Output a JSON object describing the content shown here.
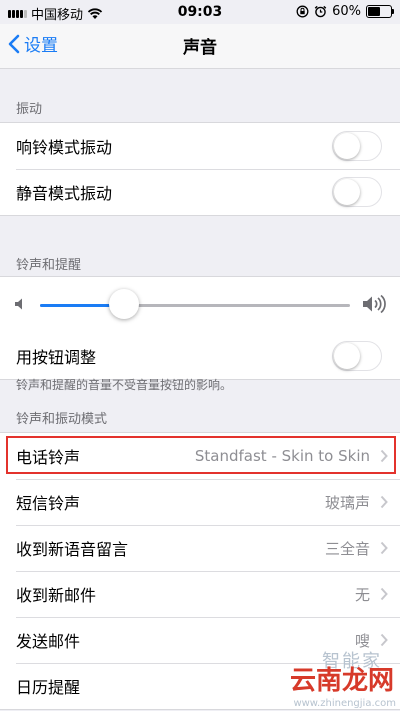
{
  "status_bar": {
    "carrier": "中国移动",
    "time": "09:03",
    "battery": "60%",
    "battery_level": 0.6
  },
  "nav": {
    "back_label": "设置",
    "title": "声音"
  },
  "vibration": {
    "header": "振动",
    "rows": [
      {
        "label": "响铃模式振动",
        "on": false
      },
      {
        "label": "静音模式振动",
        "on": false
      }
    ]
  },
  "ringer": {
    "header": "铃声和提醒",
    "volume_level": 0.27,
    "button_adjust_label": "用按钮调整",
    "button_adjust_on": false,
    "note": "铃声和提醒的音量不受音量按钮的影响。"
  },
  "patterns": {
    "header": "铃声和振动模式",
    "rows": [
      {
        "label": "电话铃声",
        "value": "Standfast - Skin to Skin"
      },
      {
        "label": "短信铃声",
        "value": "玻璃声"
      },
      {
        "label": "收到新语音留言",
        "value": "三全音"
      },
      {
        "label": "收到新邮件",
        "value": "无"
      },
      {
        "label": "发送邮件",
        "value": "嗖"
      },
      {
        "label": "日历提醒",
        "value": ""
      }
    ]
  },
  "watermark": {
    "main": "云南龙网",
    "top": "智能家",
    "url": "www.zhinengjia.com"
  },
  "colors": {
    "accent": "#1a7cf5",
    "highlight": "#e3322c",
    "background": "#efeff4"
  }
}
